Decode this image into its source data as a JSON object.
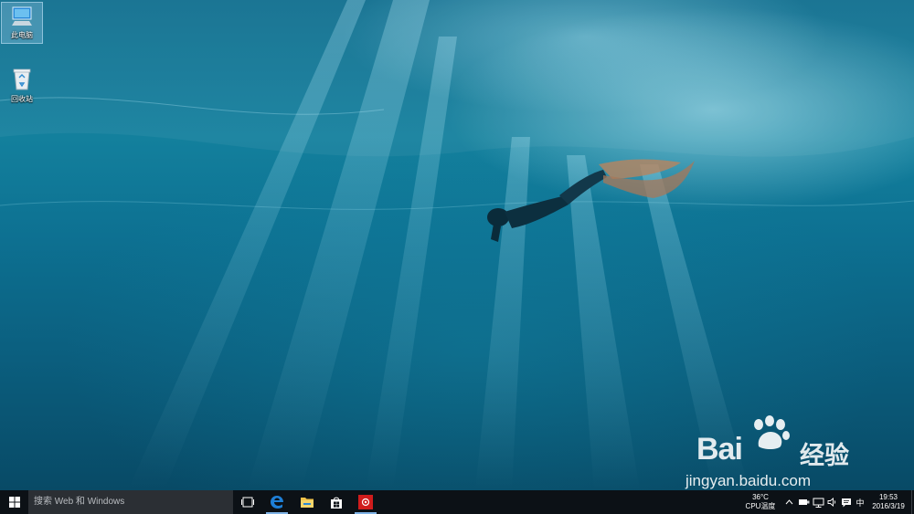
{
  "desktop": {
    "icons": [
      {
        "label": "此电脑",
        "icon": "computer-icon"
      },
      {
        "label": "回收站",
        "icon": "recycle-bin-icon"
      }
    ]
  },
  "watermark": {
    "brand": "Bai",
    "brand_suffix": "经验",
    "url": "jingyan.baidu.com"
  },
  "taskbar": {
    "search_placeholder": "搜索 Web 和 Windows",
    "pinned": [
      "task-view-icon",
      "edge-icon",
      "file-explorer-icon",
      "store-icon",
      "app-icon"
    ],
    "cpu_temp": "36°C",
    "cpu_label": "CPU温度",
    "ime": "中",
    "time": "19:53",
    "date": "2016/3/19"
  },
  "colors": {
    "taskbar": "#0c1116",
    "search_box": "#2b2f34",
    "edge_blue": "#1e7fd6",
    "explorer_yellow": "#f0c24a",
    "app_red": "#d01c1c"
  }
}
